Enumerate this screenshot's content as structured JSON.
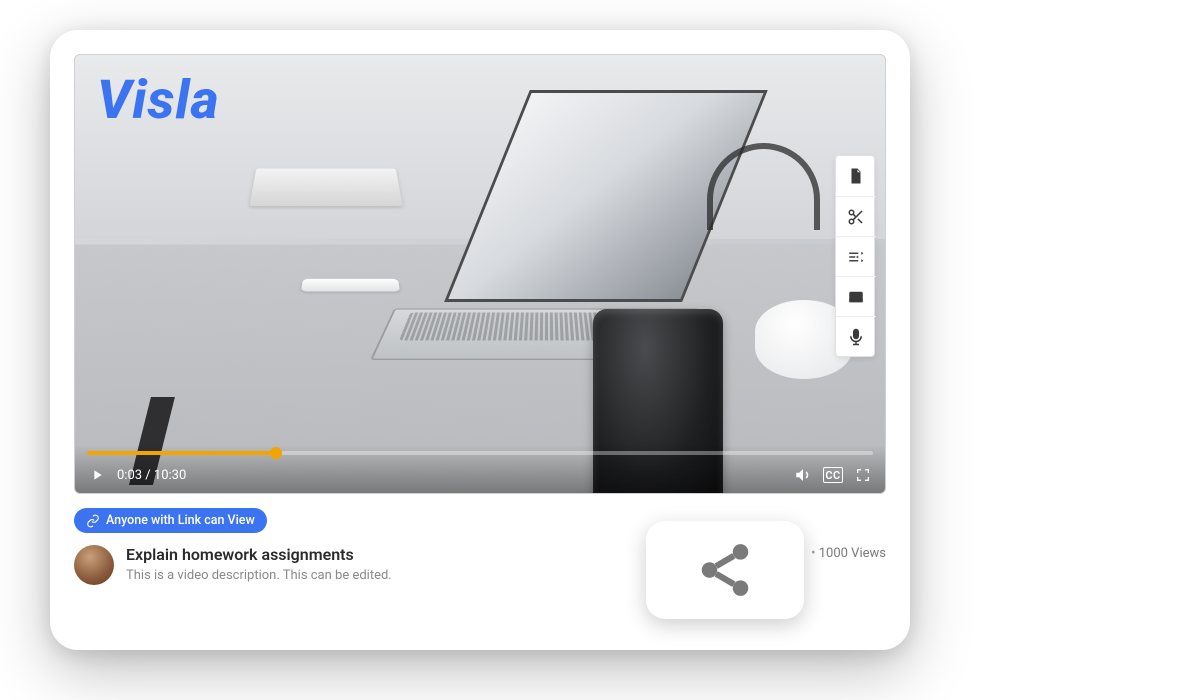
{
  "brand": "Visla",
  "player": {
    "current_time": "0:03",
    "duration": "10:30",
    "progress_percent": 24,
    "cc_label": "CC"
  },
  "toolbar": {
    "tools": [
      {
        "name": "document-icon"
      },
      {
        "name": "scissors-icon"
      },
      {
        "name": "adjust-icon"
      },
      {
        "name": "caption-bar-icon"
      },
      {
        "name": "microphone-icon"
      }
    ]
  },
  "share": {
    "pill_label": "Anyone with Link can View"
  },
  "video": {
    "title": "Explain homework assignments",
    "description": "This is a video description. This can be edited.",
    "views_label": "1000 Views"
  },
  "callout": {
    "icon": "share-icon"
  }
}
